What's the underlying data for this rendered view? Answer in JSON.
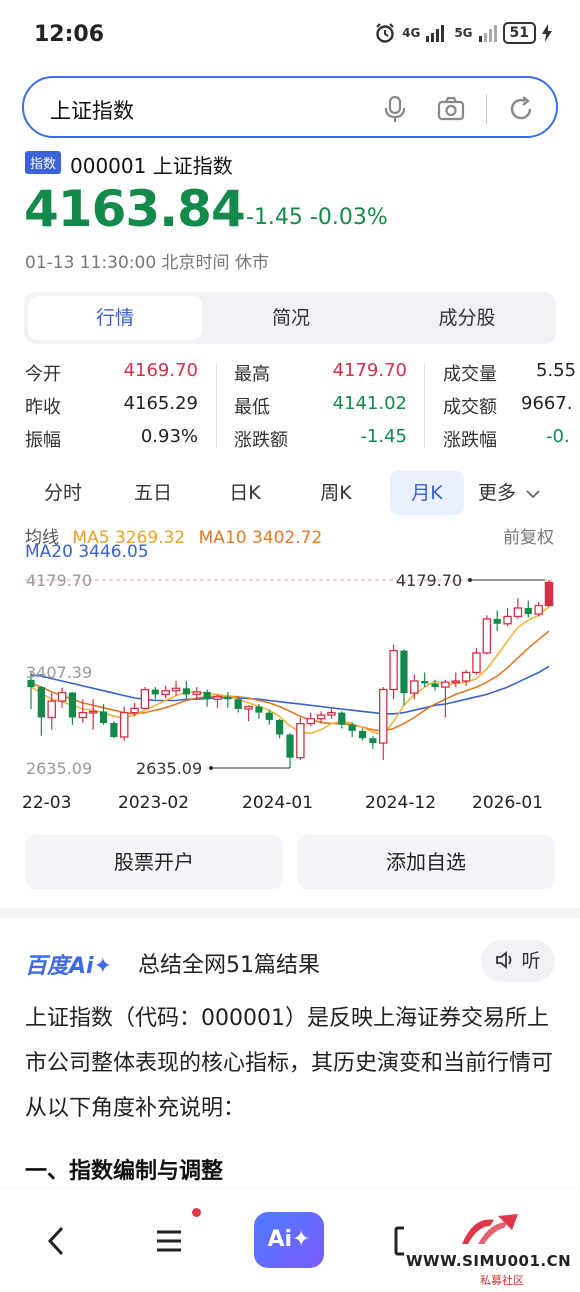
{
  "status_bar": {
    "time": "12:06",
    "net1": "4G",
    "net2": "5G",
    "battery": "51"
  },
  "search": {
    "query": "上证指数"
  },
  "stock": {
    "tag": "指数",
    "code_name": "000001 上证指数",
    "price": "4163.84",
    "change": "-1.45 -0.03%",
    "trade_time": "01-13 11:30:00 北京时间 休市"
  },
  "seg_tabs": [
    "行情",
    "简况",
    "成分股"
  ],
  "stats": {
    "col1": [
      {
        "label": "今开",
        "value": "4169.70"
      },
      {
        "label": "昨收",
        "value": "4165.29"
      },
      {
        "label": "振幅",
        "value": "0.93%"
      }
    ],
    "col2": [
      {
        "label": "最高",
        "value": "4179.70"
      },
      {
        "label": "最低",
        "value": "4141.02"
      },
      {
        "label": "涨跌额",
        "value": "-1.45"
      }
    ],
    "col3": [
      {
        "label": "成交量",
        "value": "5.55"
      },
      {
        "label": "成交额",
        "value": "9667."
      },
      {
        "label": "涨跌幅",
        "value": "-0."
      }
    ]
  },
  "period_tabs": [
    "分时",
    "五日",
    "日K",
    "周K",
    "月K",
    "更多"
  ],
  "ma": {
    "label": "均线",
    "ma5": "MA5 3269.32",
    "ma10": "MA10 3402.72",
    "ma20": "MA20 3446.05",
    "adjust": "前复权"
  },
  "chart_data": {
    "type": "candlestick",
    "y_top_label": "4179.70",
    "y_mid_label": "3407.39",
    "y_bottom_label": "2635.09",
    "max_marker": "4179.70",
    "min_marker": "2635.09",
    "x_labels": [
      "22-03",
      "2023-02",
      "2024-01",
      "2024-12",
      "2026-01"
    ],
    "ylim": [
      2635.09,
      4179.7
    ],
    "colors": {
      "up": "#d4304a",
      "down": "#138a4c",
      "ma5": "#f0b43c",
      "ma10": "#e07a28",
      "ma20": "#3a62c8"
    },
    "candles": [
      {
        "o": 3360,
        "c": 3300,
        "h": 3420,
        "l": 3120
      },
      {
        "o": 3300,
        "c": 3050,
        "h": 3310,
        "l": 2900
      },
      {
        "o": 3050,
        "c": 3185,
        "h": 3250,
        "l": 2950
      },
      {
        "o": 3185,
        "c": 3255,
        "h": 3295,
        "l": 3130
      },
      {
        "o": 3255,
        "c": 3050,
        "h": 3260,
        "l": 2990
      },
      {
        "o": 3050,
        "c": 3090,
        "h": 3200,
        "l": 3010
      },
      {
        "o": 3090,
        "c": 3100,
        "h": 3200,
        "l": 2950
      },
      {
        "o": 3100,
        "c": 3005,
        "h": 3160,
        "l": 2990
      },
      {
        "o": 3005,
        "c": 2890,
        "h": 3020,
        "l": 2880
      },
      {
        "o": 2890,
        "c": 3090,
        "h": 3140,
        "l": 2860
      },
      {
        "o": 3090,
        "c": 3125,
        "h": 3170,
        "l": 3060
      },
      {
        "o": 3125,
        "c": 3279,
        "h": 3300,
        "l": 3120
      },
      {
        "o": 3279,
        "c": 3240,
        "h": 3300,
        "l": 3200
      },
      {
        "o": 3240,
        "c": 3270,
        "h": 3310,
        "l": 3210
      },
      {
        "o": 3270,
        "c": 3290,
        "h": 3350,
        "l": 3230
      },
      {
        "o": 3290,
        "c": 3240,
        "h": 3350,
        "l": 3210
      },
      {
        "o": 3240,
        "c": 3260,
        "h": 3300,
        "l": 3200
      },
      {
        "o": 3260,
        "c": 3200,
        "h": 3280,
        "l": 3140
      },
      {
        "o": 3200,
        "c": 3220,
        "h": 3240,
        "l": 3130
      },
      {
        "o": 3220,
        "c": 3200,
        "h": 3260,
        "l": 3130
      },
      {
        "o": 3200,
        "c": 3120,
        "h": 3210,
        "l": 3090
      },
      {
        "o": 3120,
        "c": 3140,
        "h": 3150,
        "l": 3020
      },
      {
        "o": 3140,
        "c": 3090,
        "h": 3160,
        "l": 3040
      },
      {
        "o": 3090,
        "c": 3030,
        "h": 3110,
        "l": 2990
      },
      {
        "o": 3030,
        "c": 2910,
        "h": 3040,
        "l": 2880
      },
      {
        "o": 2910,
        "c": 2720,
        "h": 2920,
        "l": 2635
      },
      {
        "o": 2720,
        "c": 3000,
        "h": 3050,
        "l": 2700
      },
      {
        "o": 3000,
        "c": 3040,
        "h": 3090,
        "l": 2980
      },
      {
        "o": 3040,
        "c": 3070,
        "h": 3100,
        "l": 3000
      },
      {
        "o": 3070,
        "c": 3090,
        "h": 3120,
        "l": 3040
      },
      {
        "o": 3090,
        "c": 2990,
        "h": 3100,
        "l": 2960
      },
      {
        "o": 2990,
        "c": 2940,
        "h": 3010,
        "l": 2890
      },
      {
        "o": 2940,
        "c": 2880,
        "h": 2960,
        "l": 2860
      },
      {
        "o": 2880,
        "c": 2840,
        "h": 2900,
        "l": 2790
      },
      {
        "o": 2840,
        "c": 3280,
        "h": 3300,
        "l": 2700
      },
      {
        "o": 3280,
        "c": 3600,
        "h": 3650,
        "l": 3200
      },
      {
        "o": 3600,
        "c": 3250,
        "h": 3610,
        "l": 3150
      },
      {
        "o": 3250,
        "c": 3350,
        "h": 3400,
        "l": 3200
      },
      {
        "o": 3350,
        "c": 3330,
        "h": 3420,
        "l": 3300
      },
      {
        "o": 3330,
        "c": 3300,
        "h": 3360,
        "l": 3270
      },
      {
        "o": 3300,
        "c": 3340,
        "h": 3360,
        "l": 3050
      },
      {
        "o": 3340,
        "c": 3350,
        "h": 3420,
        "l": 3300
      },
      {
        "o": 3350,
        "c": 3420,
        "h": 3440,
        "l": 3310
      },
      {
        "o": 3420,
        "c": 3580,
        "h": 3620,
        "l": 3400
      },
      {
        "o": 3580,
        "c": 3860,
        "h": 3890,
        "l": 3570
      },
      {
        "o": 3860,
        "c": 3820,
        "h": 3930,
        "l": 3760
      },
      {
        "o": 3820,
        "c": 3880,
        "h": 3950,
        "l": 3800
      },
      {
        "o": 3880,
        "c": 3950,
        "h": 4030,
        "l": 3860
      },
      {
        "o": 3950,
        "c": 3900,
        "h": 4010,
        "l": 3870
      },
      {
        "o": 3900,
        "c": 3970,
        "h": 4000,
        "l": 3880
      },
      {
        "o": 3970,
        "c": 4160,
        "h": 4179.7,
        "l": 3960
      }
    ],
    "ma5": [
      3300,
      3250,
      3200,
      3180,
      3150,
      3120,
      3110,
      3090,
      3060,
      3050,
      3070,
      3110,
      3150,
      3190,
      3230,
      3260,
      3260,
      3250,
      3240,
      3225,
      3200,
      3170,
      3140,
      3110,
      3060,
      2980,
      2930,
      2920,
      2950,
      3000,
      3020,
      3000,
      2970,
      2930,
      2910,
      3020,
      3150,
      3240,
      3300,
      3350,
      3320,
      3330,
      3340,
      3370,
      3450,
      3560,
      3680,
      3790,
      3850,
      3890,
      3960
    ],
    "ma10": [
      3330,
      3300,
      3260,
      3230,
      3200,
      3170,
      3150,
      3130,
      3110,
      3090,
      3080,
      3090,
      3110,
      3130,
      3160,
      3190,
      3210,
      3220,
      3225,
      3225,
      3220,
      3210,
      3190,
      3170,
      3140,
      3100,
      3060,
      3030,
      3010,
      3000,
      3000,
      2990,
      2970,
      2950,
      2940,
      2960,
      3000,
      3050,
      3110,
      3160,
      3200,
      3240,
      3270,
      3300,
      3340,
      3390,
      3460,
      3540,
      3620,
      3690,
      3760
    ],
    "ma20": [
      3400,
      3390,
      3370,
      3350,
      3330,
      3310,
      3290,
      3270,
      3250,
      3230,
      3210,
      3200,
      3190,
      3190,
      3190,
      3200,
      3200,
      3205,
      3210,
      3210,
      3210,
      3205,
      3200,
      3190,
      3180,
      3170,
      3160,
      3150,
      3140,
      3130,
      3120,
      3110,
      3100,
      3090,
      3080,
      3080,
      3090,
      3110,
      3130,
      3150,
      3160,
      3180,
      3200,
      3220,
      3240,
      3270,
      3300,
      3340,
      3380,
      3420,
      3470
    ]
  },
  "buttons": {
    "open_account": "股票开户",
    "add_watch": "添加自选"
  },
  "ai": {
    "logo": "百度Ai✦",
    "title": "总结全网51篇结果",
    "listen": "听",
    "para": "上证指数（代码：000001）是反映上海证券交易所上市公司整体表现的核心指标，其历史演变和当前行情可从以下角度补充说明：",
    "heading": "一、指数编制与调整"
  },
  "bottom_nav": {
    "ai_label": "Ai✦"
  },
  "watermark": {
    "url": "WWW.SIMU001.CN",
    "sub": "私募社区"
  }
}
